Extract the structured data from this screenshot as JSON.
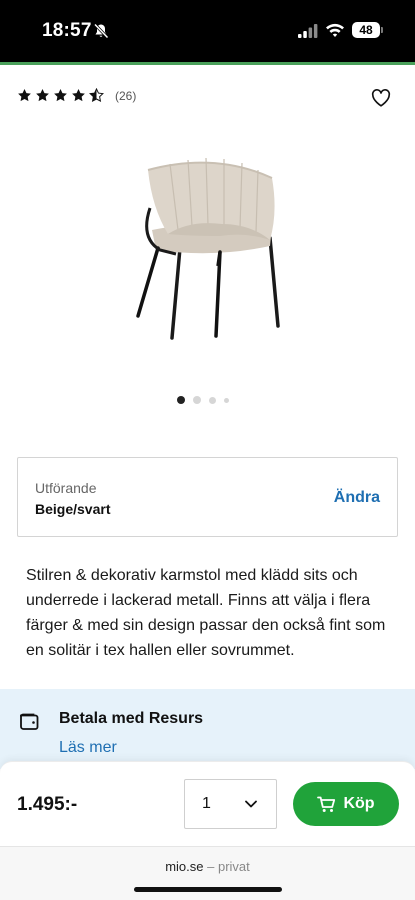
{
  "status_bar": {
    "time": "18:57",
    "battery": "48"
  },
  "product": {
    "rating": 4.5,
    "review_count": "(26)",
    "image_page_index": 1,
    "image_page_count": 4
  },
  "variant": {
    "label": "Utförande",
    "value": "Beige/svart",
    "change_label": "Ändra"
  },
  "description": "Stilren & dekorativ karmstol med klädd sits och underrede i lackerad metall. Finns att välja i flera färger & med sin design passar den också fint som en solitär i tex hallen eller sovrummet.",
  "payment": {
    "title": "Betala med Resurs",
    "link": "Läs mer"
  },
  "purchase": {
    "price": "1.495:-",
    "quantity": "1",
    "buy_label": "Köp"
  },
  "browser": {
    "domain": "mio.se",
    "mode": "– privat"
  },
  "colors": {
    "accent_green": "#20a33a",
    "link_blue": "#1f6fb2",
    "info_panel": "#e6f2fa"
  }
}
